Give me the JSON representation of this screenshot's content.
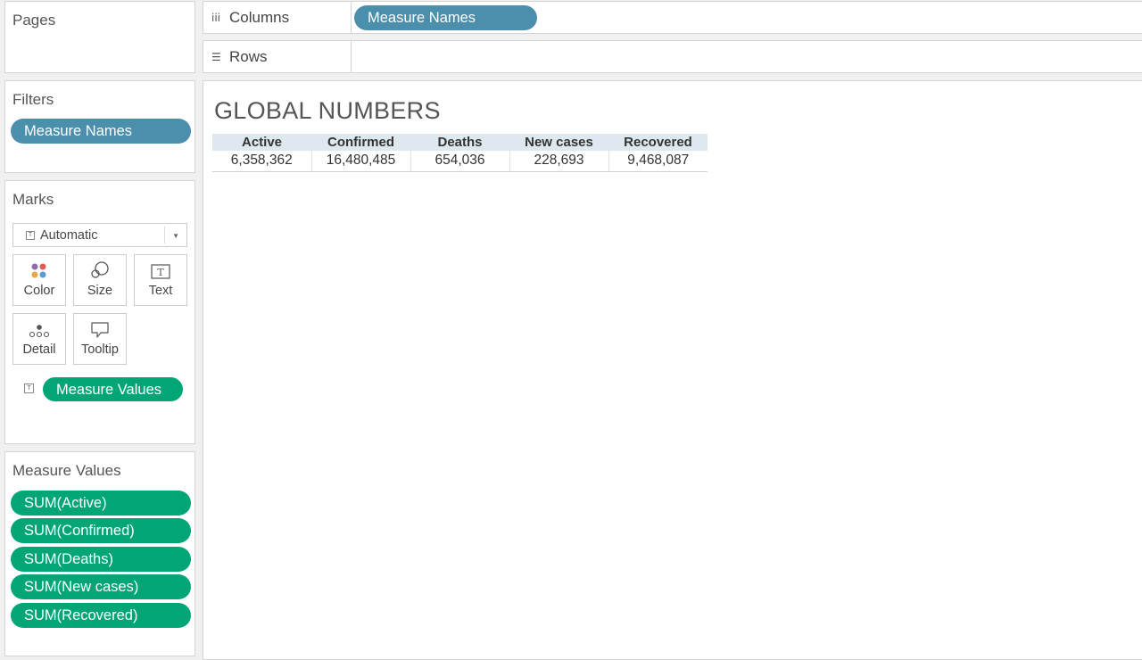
{
  "pages": {
    "title": "Pages"
  },
  "filters": {
    "title": "Filters",
    "pills": [
      "Measure Names"
    ]
  },
  "marks": {
    "title": "Marks",
    "type_selected": "Automatic",
    "buttons": [
      {
        "label": "Color",
        "icon": "color-icon"
      },
      {
        "label": "Size",
        "icon": "size-icon"
      },
      {
        "label": "Text",
        "icon": "text-icon"
      },
      {
        "label": "Detail",
        "icon": "detail-icon"
      },
      {
        "label": "Tooltip",
        "icon": "tooltip-icon"
      }
    ],
    "text_pill": "Measure Values"
  },
  "measure_values": {
    "title": "Measure Values",
    "pills": [
      "SUM(Active)",
      "SUM(Confirmed)",
      "SUM(Deaths)",
      "SUM(New cases)",
      "SUM(Recovered)"
    ]
  },
  "columns_shelf": {
    "label": "Columns",
    "pill": "Measure Names"
  },
  "rows_shelf": {
    "label": "Rows"
  },
  "view": {
    "title": "GLOBAL NUMBERS",
    "table": {
      "headers": [
        "Active",
        "Confirmed",
        "Deaths",
        "New cases",
        "Recovered"
      ],
      "values": [
        "6,358,362",
        "16,480,485",
        "654,036",
        "228,693",
        "9,468,087"
      ]
    }
  },
  "colors": {
    "dimension_pill": "#4b8fad",
    "measure_pill": "#02a676",
    "header_bg": "#dde8ef"
  }
}
